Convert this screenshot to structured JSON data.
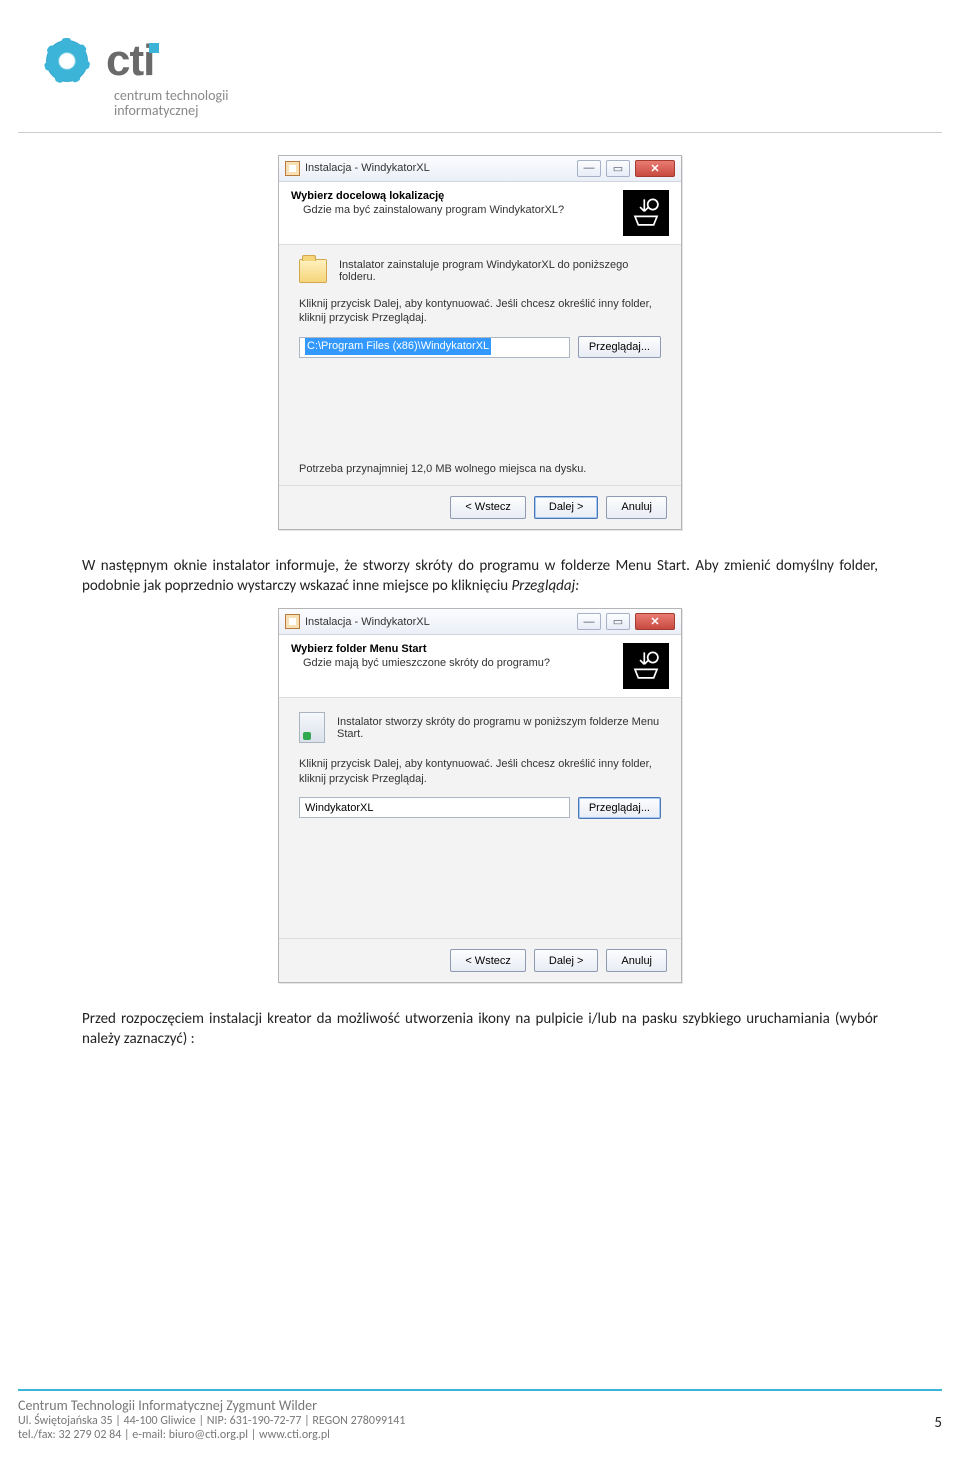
{
  "header": {
    "brand": "cti",
    "sub1": "centrum technologii",
    "sub2": "informatycznej"
  },
  "dialog1": {
    "title": "Instalacja - WindykatorXL",
    "heading": "Wybierz docelową lokalizację",
    "subheading": "Gdzie ma być zainstalowany program WindykatorXL?",
    "line1": "Instalator zainstaluje program WindykatorXL do poniższego folderu.",
    "instr": "Kliknij przycisk Dalej, aby kontynuować. Jeśli chcesz określić inny folder, kliknij przycisk Przeglądaj.",
    "path": "C:\\Program Files (x86)\\WindykatorXL",
    "browse": "Przeglądaj...",
    "diskNote": "Potrzeba przynajmniej 12,0 MB wolnego miejsca na dysku.",
    "back": "< Wstecz",
    "next": "Dalej >",
    "cancel": "Anuluj"
  },
  "para1": "W następnym oknie instalator informuje, że stworzy skróty do programu w folderze Menu Start. Aby zmienić domyślny folder, podobnie jak poprzednio wystarczy wskazać inne miejsce po kliknięciu ",
  "para1em": "Przeglądaj:",
  "dialog2": {
    "title": "Instalacja - WindykatorXL",
    "heading": "Wybierz folder Menu Start",
    "subheading": "Gdzie mają być umieszczone skróty do programu?",
    "line1": "Instalator stworzy skróty do programu w poniższym folderze Menu Start.",
    "instr": "Kliknij przycisk Dalej, aby kontynuować. Jeśli chcesz określić inny folder, kliknij przycisk Przeglądaj.",
    "path": "WindykatorXL",
    "browse": "Przeglądaj...",
    "back": "< Wstecz",
    "next": "Dalej >",
    "cancel": "Anuluj"
  },
  "para2": "Przed rozpoczęciem instalacji kreator da możliwość utworzenia ikony na pulpicie i/lub na pasku szybkiego uruchamiania (wybór należy zaznaczyć) :",
  "footer": {
    "l1a": "Centrum Technologii Informatycznej",
    "l1b": " Zygmunt Wilder",
    "l2": "Ul. Świętojańska 35 | 44-100 Gliwice | NIP: 631-190-72-77 | REGON 278099141",
    "l3": "tel./fax: 32 279 02 84 | e-mail: biuro@cti.org.pl | www.cti.org.pl",
    "page": "5"
  }
}
